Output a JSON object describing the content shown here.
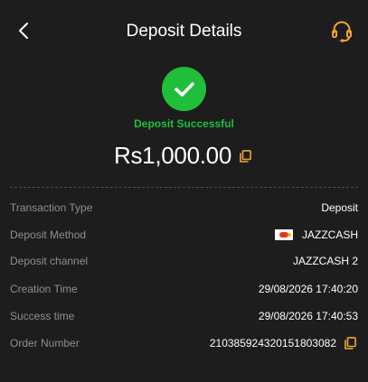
{
  "header": {
    "title": "Deposit Details"
  },
  "status": {
    "text": "Deposit Successful"
  },
  "amount": {
    "value": "Rs1,000.00"
  },
  "details": [
    {
      "label": "Transaction Type",
      "value": "Deposit"
    },
    {
      "label": "Deposit Method",
      "value": "JAZZCASH"
    },
    {
      "label": "Deposit channel",
      "value": "JAZZCASH 2"
    },
    {
      "label": "Creation Time",
      "value": "29/08/2026 17:40:20"
    },
    {
      "label": "Success time",
      "value": "29/08/2026 17:40:53"
    },
    {
      "label": "Order Number",
      "value": "210385924320151803082"
    }
  ],
  "icons": {
    "back": "back-arrow-icon",
    "support": "headset-icon",
    "success": "checkmark-icon",
    "copy": "copy-icon",
    "method_logo": "jazzcash-logo-icon"
  },
  "colors": {
    "background": "#1d1d1d",
    "success": "#1fbf3a",
    "accent": "#f2a531",
    "label": "#8f8f8f",
    "divider": "#4d4d4d"
  }
}
